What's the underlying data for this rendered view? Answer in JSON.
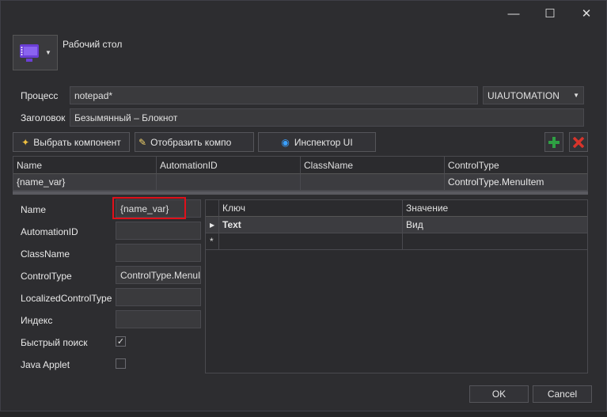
{
  "window": {
    "minimize_glyph": "—",
    "maximize_glyph": "☐",
    "close_glyph": "✕"
  },
  "target": {
    "icon": "desktop-app-icon",
    "label": "Рабочий стол"
  },
  "process": {
    "label": "Процесс",
    "value": "notepad*",
    "mode_value": "UIAUTOMATION"
  },
  "title_field": {
    "label": "Заголовок",
    "value": "Безымянный – Блокнот"
  },
  "toolbar": {
    "select_component": "Выбрать компонент",
    "show_component": "Отобразить компо",
    "inspector": "Инспектор UI"
  },
  "elements_grid": {
    "columns": [
      "Name",
      "AutomationID",
      "ClassName",
      "ControlType"
    ],
    "rows": [
      [
        "{name_var}",
        "",
        "",
        "ControlType.MenuItem"
      ]
    ]
  },
  "properties": {
    "name_label": "Name",
    "name_value": "{name_var}",
    "automation_id_label": "AutomationID",
    "automation_id_value": "",
    "class_name_label": "ClassName",
    "class_name_value": "",
    "control_type_label": "ControlType",
    "control_type_value": "ControlType.MenuI",
    "localized_label": "LocalizedControlType",
    "localized_value": "",
    "index_label": "Индекс",
    "index_value": "",
    "quick_search_label": "Быстрый поиск",
    "quick_search_checked": true,
    "java_applet_label": "Java Applet",
    "java_applet_checked": false
  },
  "kv_grid": {
    "columns": [
      "Ключ",
      "Значение"
    ],
    "rows": [
      {
        "key": "Text",
        "value": "Вид"
      }
    ],
    "new_row_marker": "*"
  },
  "footer": {
    "ok": "OK",
    "cancel": "Cancel"
  },
  "colors": {
    "highlight": "#e0101a",
    "add_green": "#2ea043",
    "delete_red": "#d9342b"
  }
}
